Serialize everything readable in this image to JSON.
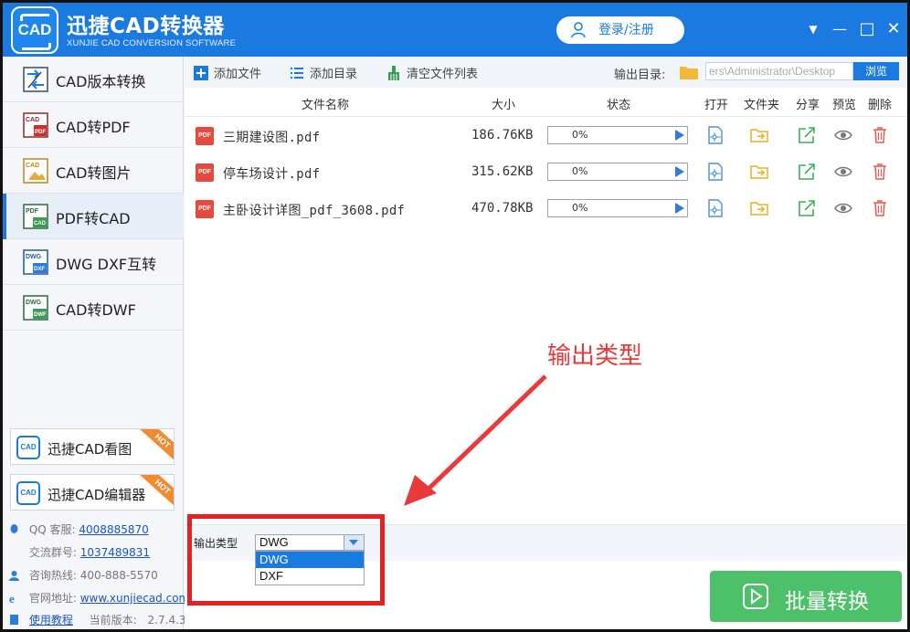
{
  "app": {
    "title": "迅捷CAD转换器",
    "subtitle": "XUNJIE CAD CONVERSION SOFTWARE",
    "logo_text": "CAD",
    "login_label": "登录/注册",
    "colors": {
      "brand": "#1a7ae0",
      "convert": "#4cc16a",
      "annotation": "#e52222"
    }
  },
  "window_controls": {
    "menu": "▼",
    "minimize": "—",
    "maximize": "□",
    "close": "✕"
  },
  "sidebar": {
    "items": [
      {
        "label": "CAD版本转换",
        "icon": "cad-version-icon",
        "icon_text": ""
      },
      {
        "label": "CAD转PDF",
        "icon": "cad-to-pdf-icon",
        "icon_text": "CAD/PDF"
      },
      {
        "label": "CAD转图片",
        "icon": "cad-to-image-icon",
        "icon_text": "CAD"
      },
      {
        "label": "PDF转CAD",
        "icon": "pdf-to-cad-icon",
        "icon_text": "PDF/CAD",
        "active": true
      },
      {
        "label": "DWG DXF互转",
        "icon": "dwg-dxf-icon",
        "icon_text": "DWG/DXF"
      },
      {
        "label": "CAD转DWF",
        "icon": "cad-to-dwf-icon",
        "icon_text": "DWG/DWF"
      }
    ],
    "promos": [
      {
        "label": "迅捷CAD看图",
        "badge": "HOT",
        "icon_text": "CAD"
      },
      {
        "label": "迅捷CAD编辑器",
        "badge": "HOT",
        "icon_text": "CAD"
      }
    ],
    "info": {
      "qq_label": "QQ 客服:",
      "qq_value": "4008885870",
      "group_label": "交流群号:",
      "group_value": "1037489831",
      "hotline_label": "咨询热线:",
      "hotline_value": "400-888-5570",
      "site_label": "官网地址:",
      "site_value": "www.xunjiecad.com",
      "tutorial_label": "使用教程",
      "version_label": "当前版本:",
      "version_value": "2.7.4.3"
    }
  },
  "toolbar": {
    "add_file": "添加文件",
    "add_dir": "添加目录",
    "clear_list": "清空文件列表",
    "output_dir_label": "输出目录:",
    "output_dir_value": "ers\\Administrator\\Desktop",
    "browse": "浏览"
  },
  "table": {
    "headers": {
      "name": "文件名称",
      "size": "大小",
      "status": "状态",
      "open": "打开",
      "folder": "文件夹",
      "share": "分享",
      "preview": "预览",
      "delete": "删除"
    },
    "rows": [
      {
        "name": "三期建设图.pdf",
        "size": "186.76KB",
        "progress": "0%",
        "progress_value": 0
      },
      {
        "name": "停车场设计.pdf",
        "size": "315.62KB",
        "progress": "0%",
        "progress_value": 0
      },
      {
        "name": "主卧设计详图_pdf_3608.pdf",
        "size": "470.78KB",
        "progress": "0%",
        "progress_value": 0
      }
    ],
    "file_badge": "PDF"
  },
  "output_options": {
    "label": "输出类型",
    "selected": "DWG",
    "options": [
      "DWG",
      "DXF"
    ]
  },
  "annotation": {
    "text": "输出类型"
  },
  "convert_button": {
    "label": "批量转换"
  }
}
